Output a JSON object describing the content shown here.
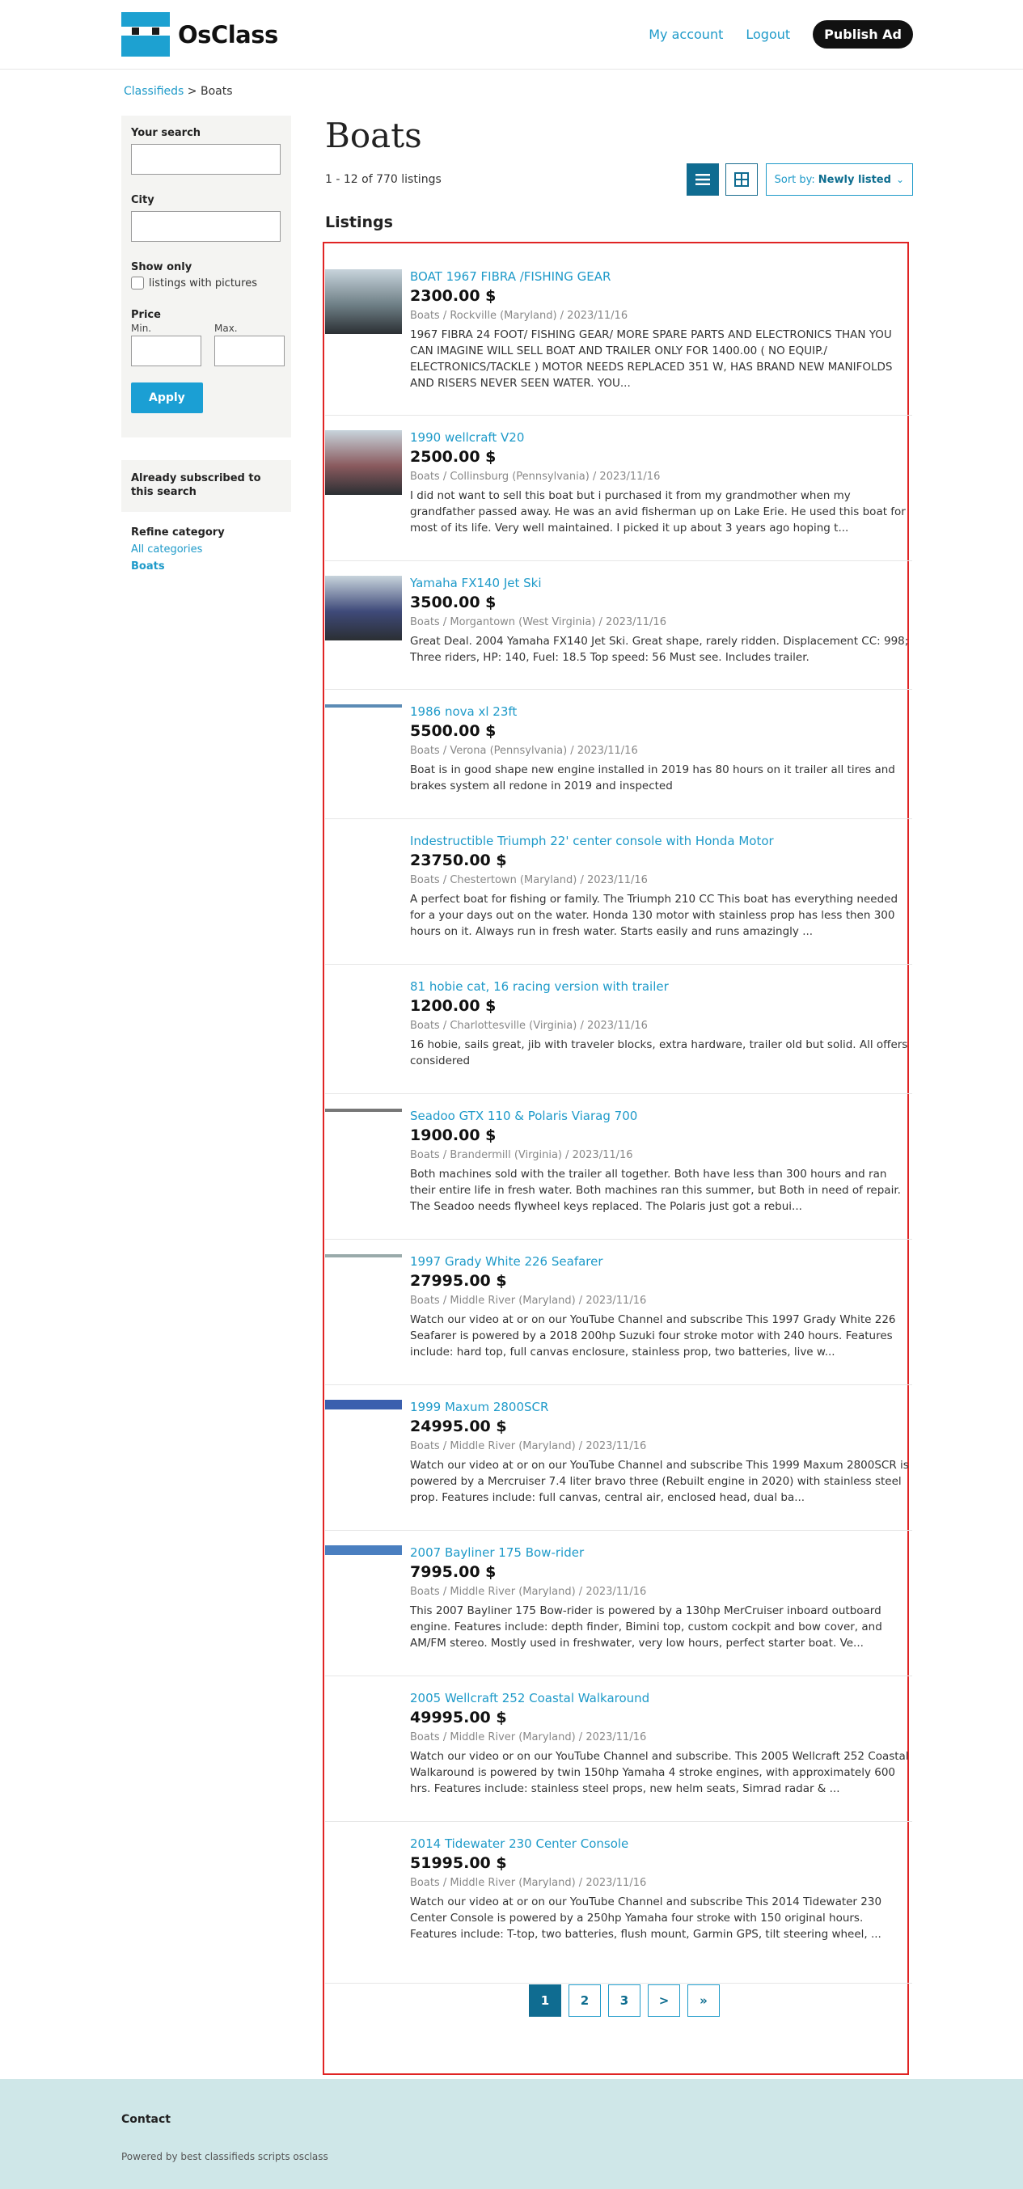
{
  "header": {
    "logo_text": "OsClass",
    "nav": {
      "my_account": "My account",
      "logout": "Logout",
      "publish": "Publish Ad"
    }
  },
  "breadcrumb": {
    "root": "Classifieds",
    "sep": ">",
    "current": "Boats"
  },
  "sidebar": {
    "your_search_label": "Your search",
    "city_label": "City",
    "show_only_label": "Show only",
    "pictures_label": "listings with pictures",
    "price_label": "Price",
    "min_label": "Min.",
    "max_label": "Max.",
    "apply_label": "Apply",
    "subscribed_text": "Already subscribed to this search",
    "refine_title": "Refine category",
    "refine_all": "All categories",
    "refine_current": "Boats"
  },
  "main": {
    "title": "Boats",
    "count": "1 - 12 of 770 listings",
    "sort_prefix": "Sort by:",
    "sort_value": "Newly listed",
    "listings_heading": "Listings"
  },
  "listings": [
    {
      "title": "BOAT 1967 FIBRA /FISHING GEAR",
      "price": "2300.00 $",
      "meta": "Boats  /  Rockville (Maryland)  /  2023/11/16",
      "desc": "1967 FIBRA 24 FOOT/ FISHING GEAR/ MORE SPARE PARTS AND ELECTRONICS THAN YOU CAN IMAGINE WILL SELL BOAT AND TRAILER ONLY FOR 1400.00 ( NO EQUIP./ ELECTRONICS/TACKLE ) MOTOR NEEDS REPLACED 351 W, HAS BRAND NEW MANIFOLDS AND RISERS NEVER SEEN WATER. YOU..."
    },
    {
      "title": "1990 wellcraft V20",
      "price": "2500.00 $",
      "meta": "Boats  /  Collinsburg (Pennsylvania)  /  2023/11/16",
      "desc": "I did not want to sell this boat but i purchased it from my grandmother when my grandfather passed away. He was an avid fisherman up on Lake Erie. He used this boat for most of its life. Very well maintained. I picked it up about 3 years ago hoping t..."
    },
    {
      "title": "Yamaha FX140 Jet Ski",
      "price": "3500.00 $",
      "meta": "Boats  /  Morgantown (West Virginia)  /  2023/11/16",
      "desc": "Great Deal. 2004 Yamaha FX140 Jet Ski. Great shape, rarely ridden. Displacement CC: 998; Three riders, HP: 140, Fuel: 18.5 Top speed: 56 Must see. Includes trailer."
    },
    {
      "title": "1986 nova xl 23ft",
      "price": "5500.00 $",
      "meta": "Boats  /  Verona (Pennsylvania)  /  2023/11/16",
      "desc": "Boat is in good shape new engine installed in 2019 has 80 hours on it trailer all tires and brakes system all redone in 2019 and inspected"
    },
    {
      "title": "Indestructible Triumph 22' center console with Honda Motor",
      "price": "23750.00 $",
      "meta": "Boats  /  Chestertown (Maryland)  /  2023/11/16",
      "desc": "A perfect boat for fishing or family. The Triumph 210 CC This boat has everything needed for a your days out on the water. Honda 130 motor with stainless prop has less then 300 hours on it. Always run in fresh water. Starts easily and runs amazingly ..."
    },
    {
      "title": "81 hobie cat, 16 racing version with trailer",
      "price": "1200.00 $",
      "meta": "Boats  /  Charlottesville (Virginia)  /  2023/11/16",
      "desc": "16 hobie, sails great, jib with traveler blocks, extra hardware, trailer old but solid. All offers considered"
    },
    {
      "title": "Seadoo GTX 110 & Polaris Viarag 700",
      "price": "1900.00 $",
      "meta": "Boats  /  Brandermill (Virginia)  /  2023/11/16",
      "desc": "Both machines sold with the trailer all together. Both have less than 300 hours and ran their entire life in fresh water. Both machines ran this summer, but Both in need of repair. The Seadoo needs flywheel keys replaced. The Polaris just got a rebui..."
    },
    {
      "title": "1997 Grady White 226 Seafarer",
      "price": "27995.00 $",
      "meta": "Boats  /  Middle River (Maryland)  /  2023/11/16",
      "desc": "Watch our video at or on our YouTube Channel and subscribe This 1997 Grady White 226 Seafarer is powered by a 2018 200hp Suzuki four stroke motor with 240 hours. Features include: hard top, full canvas enclosure, stainless prop, two batteries, live w..."
    },
    {
      "title": "1999 Maxum 2800SCR",
      "price": "24995.00 $",
      "meta": "Boats  /  Middle River (Maryland)  /  2023/11/16",
      "desc": "Watch our video at or on our YouTube Channel and subscribe This 1999 Maxum 2800SCR is powered by a Mercruiser 7.4 liter bravo three (Rebuilt engine in 2020) with stainless steel prop. Features include: full canvas, central air, enclosed head, dual ba..."
    },
    {
      "title": "2007 Bayliner 175 Bow-rider",
      "price": "7995.00 $",
      "meta": "Boats  /  Middle River (Maryland)  /  2023/11/16",
      "desc": "This 2007 Bayliner 175 Bow-rider is powered by a 130hp MerCruiser inboard outboard engine. Features include: depth finder, Bimini top, custom cockpit and bow cover, and AM/FM stereo. Mostly used in freshwater, very low hours, perfect starter boat. Ve..."
    },
    {
      "title": "2005 Wellcraft 252 Coastal Walkaround",
      "price": "49995.00 $",
      "meta": "Boats  /  Middle River (Maryland)  /  2023/11/16",
      "desc": "Watch our video or on our YouTube Channel and subscribe. This 2005 Wellcraft 252 Coastal Walkaround is powered by twin 150hp Yamaha 4 stroke engines, with approximately 600 hrs. Features include: stainless steel props, new helm seats, Simrad radar & ..."
    },
    {
      "title": "2014 Tidewater 230 Center Console",
      "price": "51995.00 $",
      "meta": "Boats  /  Middle River (Maryland)  /  2023/11/16",
      "desc": "Watch our video at or on our YouTube Channel and subscribe This 2014 Tidewater 230 Center Console is powered by a 250hp Yamaha four stroke with 150 original hours. Features include: T-top, two batteries, flush mount, Garmin GPS, tilt steering wheel, ..."
    }
  ],
  "pagination": [
    "1",
    "2",
    "3",
    ">",
    "»"
  ],
  "footer": {
    "contact": "Contact",
    "powered": "Powered by best classifieds scripts osclass"
  },
  "colors": {
    "accent": "#1e9ac9",
    "dark_accent": "#0f6c91",
    "highlight_frame": "#e02424",
    "footer_bg": "#cfe7e8"
  }
}
